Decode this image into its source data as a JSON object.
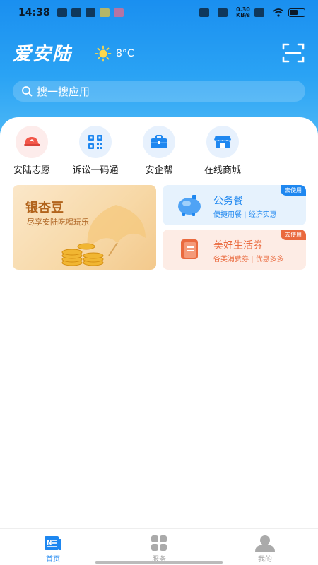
{
  "status_bar": {
    "time": "14:38",
    "net_speed_value": "0.30",
    "net_speed_unit": "KB/s"
  },
  "header": {
    "brand_title": "爱安陆",
    "weather_temp": "8°C",
    "weather_icon": "sun-icon",
    "scan_icon": "scan-icon"
  },
  "search": {
    "placeholder": "搜一搜应用"
  },
  "quick_entries": [
    {
      "label": "安陆志愿",
      "icon": "volunteer-hat-icon",
      "color": "#f2574a"
    },
    {
      "label": "诉讼一码通",
      "icon": "qr-code-icon",
      "color": "#1e87f0"
    },
    {
      "label": "安企帮",
      "icon": "briefcase-icon",
      "color": "#1e87f0"
    },
    {
      "label": "在线商城",
      "icon": "store-icon",
      "color": "#1e87f0"
    }
  ],
  "promo_main": {
    "title": "银杏豆",
    "subtitle": "尽享安陆吃喝玩乐"
  },
  "promo_cards": [
    {
      "title": "公务餐",
      "subtitle": "便捷用餐 | 经济实惠",
      "badge": "去使用",
      "accent": "#1e87f0"
    },
    {
      "title": "美好生活券",
      "subtitle": "各类消费券 | 优惠多多",
      "badge": "去使用",
      "accent": "#ea6a3e"
    }
  ],
  "tabbar": {
    "tabs": [
      {
        "label": "首页",
        "active": true
      },
      {
        "label": "服务",
        "active": false
      },
      {
        "label": "我的",
        "active": false
      }
    ]
  },
  "colors": {
    "primary": "#1e87f0",
    "tab_inactive": "#aaaaaa"
  }
}
